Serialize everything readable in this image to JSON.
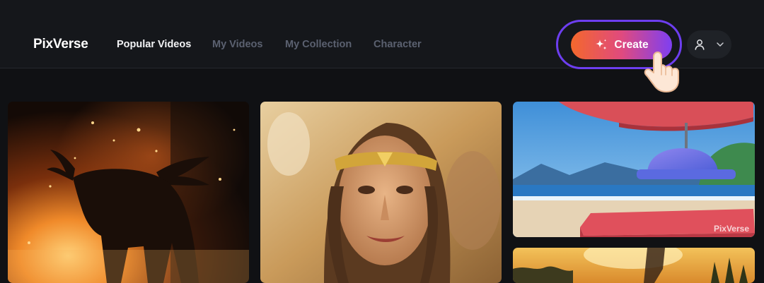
{
  "header": {
    "logo": "PixVerse",
    "nav": [
      {
        "label": "Popular Videos",
        "active": true
      },
      {
        "label": "My Videos",
        "active": false
      },
      {
        "label": "My Collection",
        "active": false
      },
      {
        "label": "Character",
        "active": false
      }
    ],
    "create_label": "Create",
    "create_icon": "sparkle-icon",
    "user_icon": "user-icon",
    "user_menu_icon": "chevron-down-icon"
  },
  "gallery": {
    "items": [
      {
        "subject": "moose-in-fire"
      },
      {
        "subject": "woman-with-golden-tiara"
      },
      {
        "subject": "beach-umbrella-hat",
        "watermark": "PixVerse"
      },
      {
        "subject": "sunset-scene"
      }
    ]
  },
  "colors": {
    "background": "#101114",
    "header": "#15171b",
    "accent_start": "#f4682c",
    "accent_mid": "#e04a7e",
    "accent_end": "#7e3ff2",
    "ring": "#6d3ef0"
  }
}
